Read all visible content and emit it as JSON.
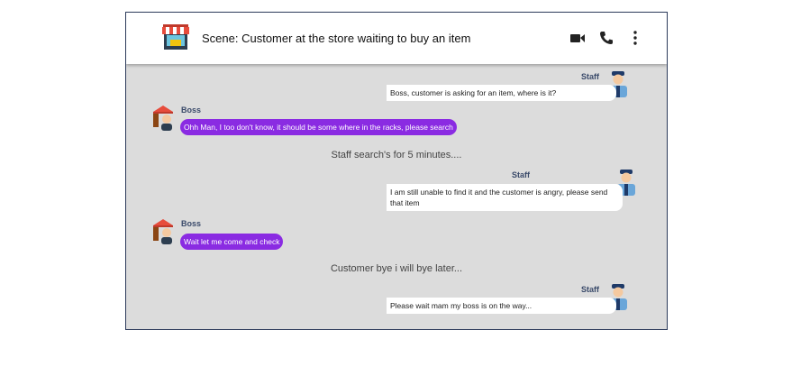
{
  "header": {
    "title": "Scene: Customer at the store waiting to buy an item",
    "icons": [
      "store-icon",
      "video-call-icon",
      "phone-icon",
      "more-options-icon"
    ]
  },
  "messages": [
    {
      "sender": "Staff",
      "text": "Boss, customer is asking for an item, where is it?"
    },
    {
      "sender": "Boss",
      "text": "Ohh Man, I too don't know, it should be some where in the racks, please search"
    },
    {
      "narration": "Staff search's for 5 minutes...."
    },
    {
      "sender": "Staff",
      "text": "I am still unable to find it and the customer is angry, please send that item"
    },
    {
      "sender": "Boss",
      "text": "Wait let me come and check"
    },
    {
      "narration": "Customer bye i will bye later..."
    },
    {
      "sender": "Staff",
      "text": "Please wait mam my boss is on the way..."
    }
  ],
  "colors": {
    "boss_bubble": "#8a2be2",
    "chat_bg": "#dcdcdc",
    "staff_bubble": "#ffffff"
  }
}
